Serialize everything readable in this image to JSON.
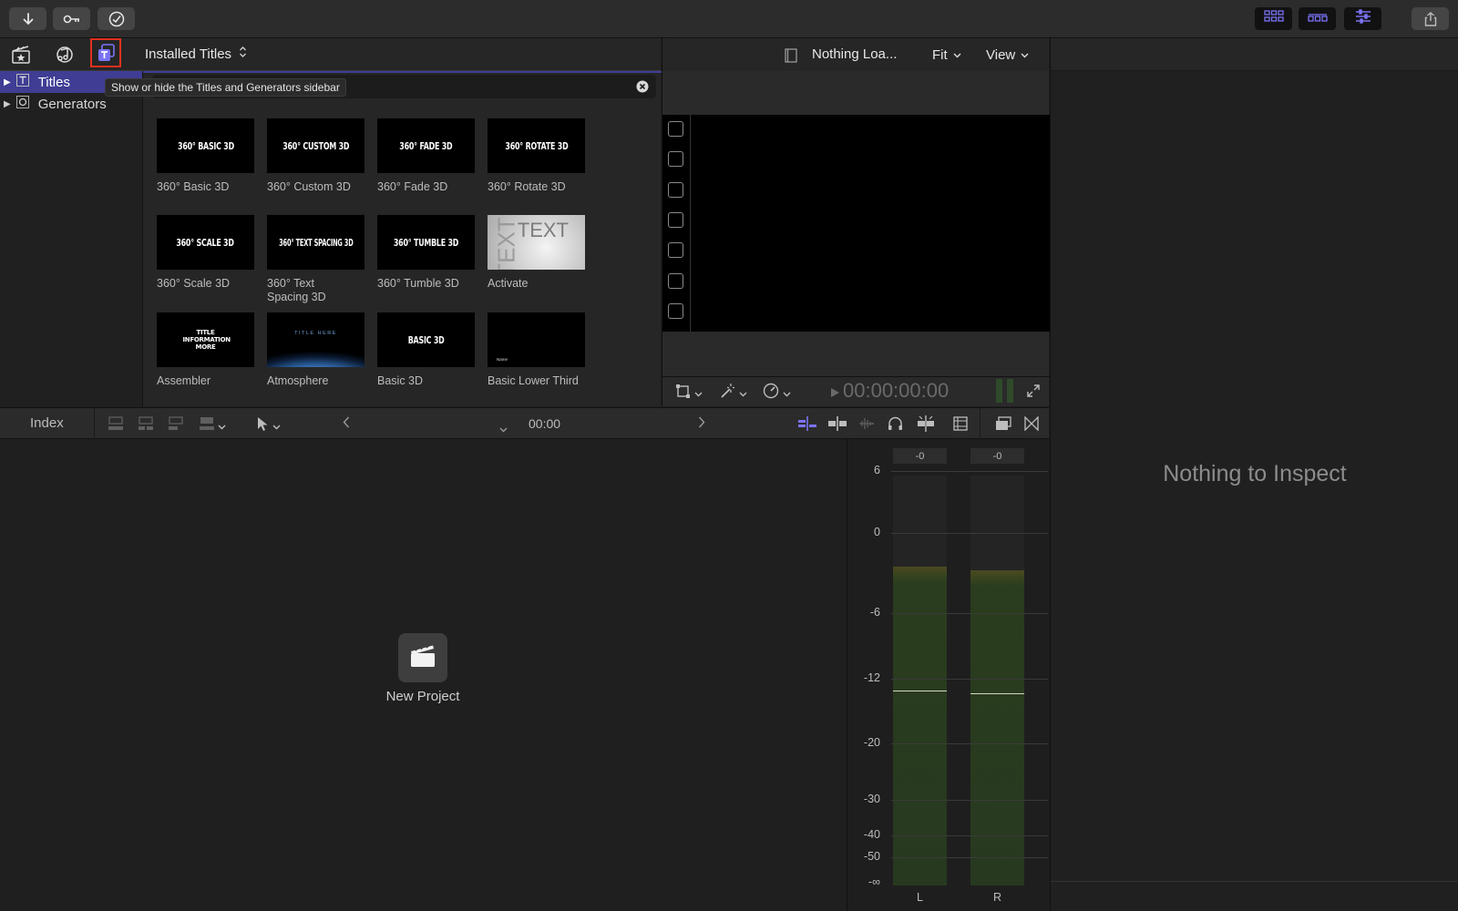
{
  "toolbar": {
    "import_icon": "download-arrow-icon",
    "keyword_icon": "key-icon",
    "background_tasks_icon": "checkmark-circle-icon",
    "view_buttons": [
      "browser-layout-icon",
      "timeline-layout-icon",
      "inspector-layout-icon"
    ],
    "share_icon": "share-icon",
    "accent": "#7b73f5"
  },
  "browser": {
    "library_icon": "clapperboard-star-icon",
    "photos_icon": "photos-music-icon",
    "titles_icon": "titles-generators-icon",
    "selector_label": "Installed Titles",
    "tooltip": "Show or hide the Titles and Generators sidebar",
    "sidebar": [
      {
        "label": "Titles",
        "selected": true
      },
      {
        "label": "Generators",
        "selected": false
      }
    ],
    "tiles": [
      {
        "thumb": "360° BASIC 3D",
        "label": "360° Basic 3D"
      },
      {
        "thumb": "360° CUSTOM 3D",
        "label": "360° Custom 3D"
      },
      {
        "thumb": "360° FADE 3D",
        "label": "360° Fade 3D"
      },
      {
        "thumb": "360° ROTATE 3D",
        "label": "360° Rotate 3D"
      },
      {
        "thumb": "360° SCALE 3D",
        "label": "360° Scale 3D"
      },
      {
        "thumb": "360° TEXT SPACING 3D",
        "label": "360° Text Spacing 3D"
      },
      {
        "thumb": "360° TUMBLE 3D",
        "label": "360° Tumble 3D"
      },
      {
        "thumb": "TEXT",
        "label": "Activate"
      },
      {
        "thumb": "TITLE INFORMATION MORE",
        "label": "Assembler"
      },
      {
        "thumb": "TITLE HERE",
        "label": "Atmosphere"
      },
      {
        "thumb": "BASIC 3D",
        "label": "Basic 3D"
      },
      {
        "thumb": "Name",
        "label": "Basic Lower Third"
      }
    ]
  },
  "viewer": {
    "title": "Nothing Loa...",
    "fit_label": "Fit",
    "view_label": "View",
    "timecode": "00:00:00:00"
  },
  "inspector": {
    "empty_text": "Nothing to Inspect"
  },
  "timeline": {
    "index_label": "Index",
    "timecode": "00:00",
    "new_project_label": "New Project"
  },
  "meters": {
    "peak_left": "-0",
    "peak_right": "-0",
    "scale": [
      "6",
      "0",
      "-6",
      "-12",
      "-20",
      "-30",
      "-40",
      "-50",
      "-∞"
    ],
    "channel_left": "L",
    "channel_right": "R",
    "level_left_db": -2.5,
    "level_right_db": -2.8
  }
}
